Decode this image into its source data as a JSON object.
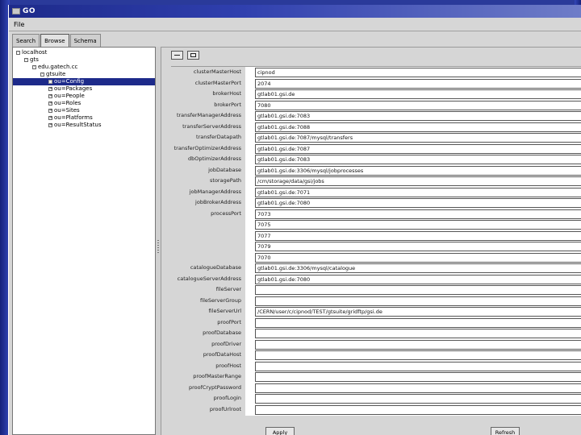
{
  "window": {
    "title": "GO"
  },
  "menu": {
    "file": "File"
  },
  "tabs": [
    {
      "label": "Search",
      "active": false
    },
    {
      "label": "Browse",
      "active": true
    },
    {
      "label": "Schema",
      "active": false
    }
  ],
  "tree": [
    {
      "label": "localhost",
      "depth": 0,
      "expander": "-"
    },
    {
      "label": "gts",
      "depth": 1,
      "expander": "-"
    },
    {
      "label": "edu.gatech.cc",
      "depth": 2,
      "expander": "-"
    },
    {
      "label": "gtsuite",
      "depth": 3,
      "expander": "-"
    },
    {
      "label": "ou=Config",
      "depth": 4,
      "expander": "",
      "selected": true
    },
    {
      "label": "ou=Packages",
      "depth": 4,
      "expander": "+"
    },
    {
      "label": "ou=People",
      "depth": 4,
      "expander": "+"
    },
    {
      "label": "ou=Roles",
      "depth": 4,
      "expander": "+"
    },
    {
      "label": "ou=Sites",
      "depth": 4,
      "expander": "+"
    },
    {
      "label": "ou=Platforms",
      "depth": 4,
      "expander": "+"
    },
    {
      "label": "ou=ResultStatus",
      "depth": 4,
      "expander": "+"
    }
  ],
  "fields": [
    {
      "label": "clusterMasterHost",
      "value": "cipnod"
    },
    {
      "label": "clusterMasterPort",
      "value": "2074"
    },
    {
      "label": "brokerHost",
      "value": "gtlab01.gsi.de"
    },
    {
      "label": "brokerPort",
      "value": "7080"
    },
    {
      "label": "transferManagerAddress",
      "value": "gtlab01.gsi.de:7083"
    },
    {
      "label": "transferServerAddress",
      "value": "gtlab01.gsi.de:7088"
    },
    {
      "label": "transferDatapath",
      "value": "gtlab01.gsi.de:7087/mysql/transfers"
    },
    {
      "label": "transferOptimizerAddress",
      "value": "gtlab01.gsi.de:7087"
    },
    {
      "label": "dbOptimizerAddress",
      "value": "gtlab01.gsi.de:7083"
    },
    {
      "label": "jobDatabase",
      "value": "gtlab01.gsi.de:3306/mysql/jobprocesses"
    },
    {
      "label": "storagePath",
      "value": "/cm/storage/data/gsi/jobs"
    },
    {
      "label": "jobManagerAddress",
      "value": "gtlab01.gsi.de:7071"
    },
    {
      "label": "jobBrokerAddress",
      "value": "gtlab01.gsi.de:7080"
    },
    {
      "label": "processPort",
      "value": "7073"
    },
    {
      "label": "",
      "value": "7075"
    },
    {
      "label": "",
      "value": "7077"
    },
    {
      "label": "",
      "value": "7079"
    },
    {
      "label": "",
      "value": "7070"
    },
    {
      "label": "catalogueDatabase",
      "value": "gtlab01.gsi.de:3306/mysql/catalogue"
    },
    {
      "label": "catalogueServerAddress",
      "value": "gtlab01.gsi.de:7080"
    },
    {
      "label": "fileServer",
      "value": ""
    },
    {
      "label": "fileServerGroup",
      "value": ""
    },
    {
      "label": "fileServerUrl",
      "value": "/CERN/user/c/cipnod/TEST/gtsuite/gridftp/gsi.de"
    },
    {
      "label": "proofPort",
      "value": ""
    },
    {
      "label": "proofDatabase",
      "value": ""
    },
    {
      "label": "proofDriver",
      "value": ""
    },
    {
      "label": "proofDataHost",
      "value": ""
    },
    {
      "label": "proofHost",
      "value": ""
    },
    {
      "label": "proofMasterRange",
      "value": ""
    },
    {
      "label": "proofCryptPassword",
      "value": ""
    },
    {
      "label": "proofLogin",
      "value": ""
    },
    {
      "label": "proofUrlroot",
      "value": ""
    }
  ],
  "buttons": {
    "apply": "Apply",
    "refresh": "Refresh"
  }
}
